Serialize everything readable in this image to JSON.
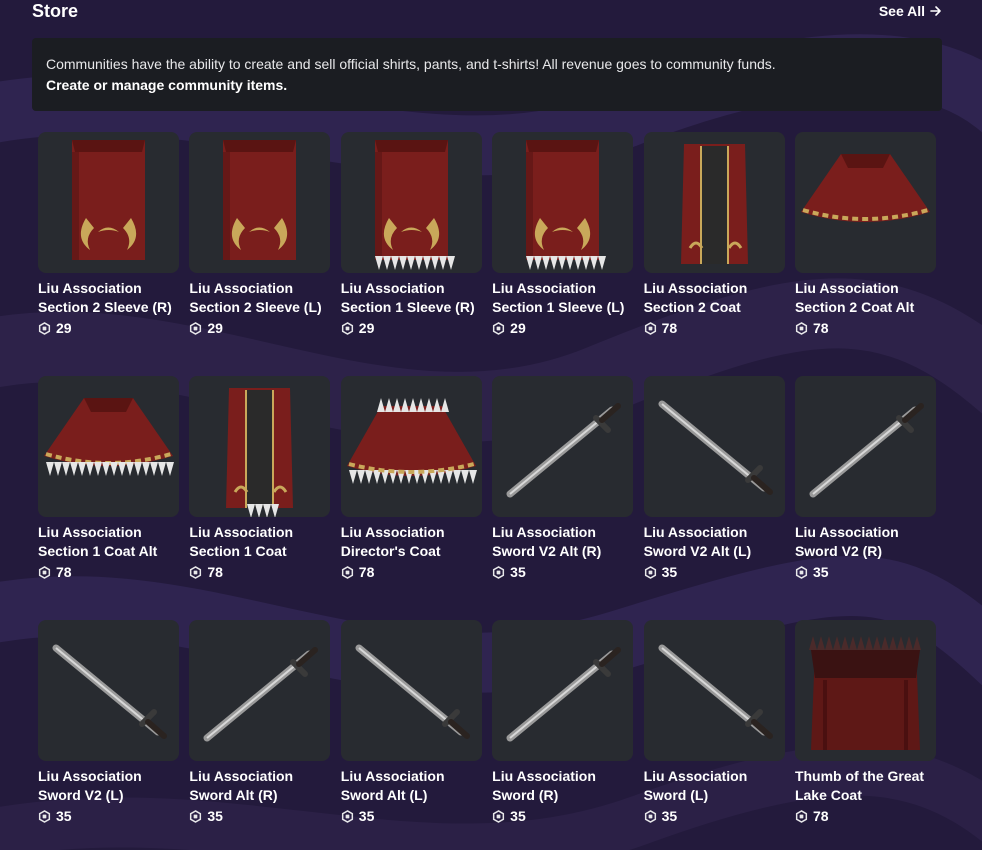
{
  "header": {
    "title": "Store",
    "see_all_label": "See All"
  },
  "info": {
    "text": "Communities have the ability to create and sell official shirts, pants, and t-shirts! All revenue goes to community funds.",
    "link_label": "Create or manage community items."
  },
  "items": [
    {
      "name": "Liu Association Section 2 Sleeve (R)",
      "price": "29",
      "kind": "sleeve"
    },
    {
      "name": "Liu Association Section 2 Sleeve (L)",
      "price": "29",
      "kind": "sleeve"
    },
    {
      "name": "Liu Association Section 1 Sleeve (R)",
      "price": "29",
      "kind": "sleeve-fur"
    },
    {
      "name": "Liu Association Section 1 Sleeve (L)",
      "price": "29",
      "kind": "sleeve-fur"
    },
    {
      "name": "Liu Association Section 2 Coat",
      "price": "78",
      "kind": "coat"
    },
    {
      "name": "Liu Association Section 2 Coat Alt",
      "price": "78",
      "kind": "cape"
    },
    {
      "name": "Liu Association Section 1 Coat Alt",
      "price": "78",
      "kind": "cape-fur"
    },
    {
      "name": "Liu Association Section 1 Coat",
      "price": "78",
      "kind": "coat-fur"
    },
    {
      "name": "Liu Association Director's Coat",
      "price": "78",
      "kind": "cape-collar"
    },
    {
      "name": "Liu Association Sword V2 Alt (R)",
      "price": "35",
      "kind": "sword-up"
    },
    {
      "name": "Liu Association Sword V2 Alt (L)",
      "price": "35",
      "kind": "sword-down"
    },
    {
      "name": "Liu Association Sword V2 (R)",
      "price": "35",
      "kind": "sword-up"
    },
    {
      "name": "Liu Association Sword V2 (L)",
      "price": "35",
      "kind": "sword-down"
    },
    {
      "name": "Liu Association Sword Alt (R)",
      "price": "35",
      "kind": "sword-up"
    },
    {
      "name": "Liu Association Sword Alt (L)",
      "price": "35",
      "kind": "sword-down"
    },
    {
      "name": "Liu Association Sword (R)",
      "price": "35",
      "kind": "sword-up"
    },
    {
      "name": "Liu Association Sword (L)",
      "price": "35",
      "kind": "sword-down"
    },
    {
      "name": "Thumb of the Great Lake Coat",
      "price": "78",
      "kind": "fur-coat"
    }
  ],
  "colors": {
    "background": "#231a3c",
    "card": "#282b30",
    "info_box": "#1b1d22",
    "cloth": "#7a1e1c",
    "gold": "#c9a85a"
  }
}
